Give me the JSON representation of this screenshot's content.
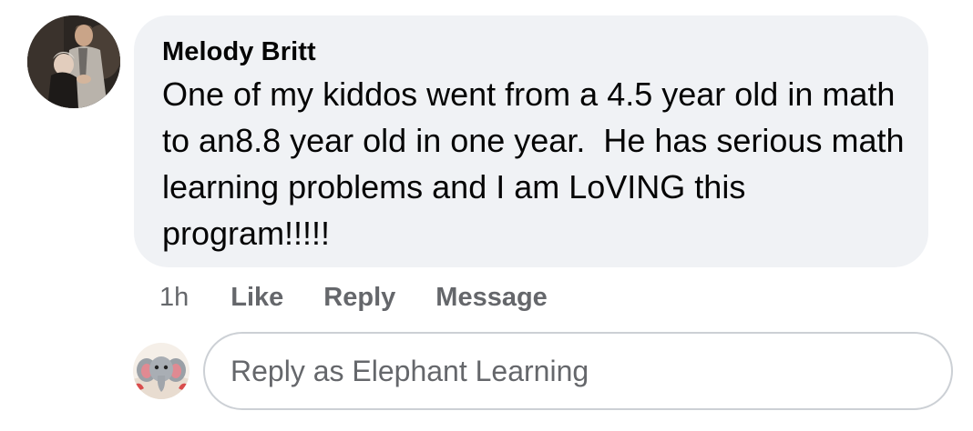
{
  "comment": {
    "author": "Melody Britt",
    "text": "One of my kiddos went from a 4.5 year old in math to an8.8 year old in one year.  He has serious math learning problems and I am LoVING this program!!!!!",
    "time": "1h",
    "actions": {
      "like": "Like",
      "reply": "Reply",
      "message": "Message"
    }
  },
  "reply_box": {
    "placeholder": "Reply as Elephant Learning"
  },
  "colors": {
    "bubble_bg": "#f0f2f5",
    "text_primary": "#050505",
    "text_secondary": "#65676b",
    "input_border": "#ccd0d5"
  }
}
